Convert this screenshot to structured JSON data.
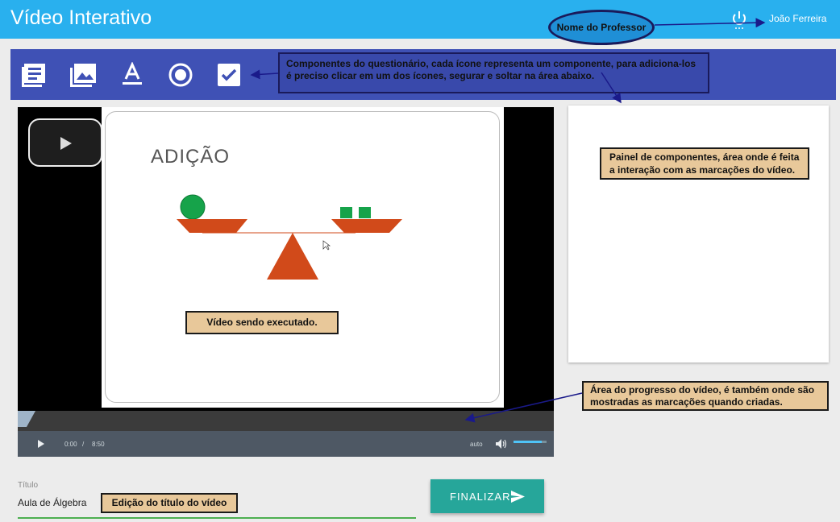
{
  "header": {
    "title": "Vídeo Interativo",
    "user_name": "João Ferreira",
    "power_icon": "power-icon"
  },
  "toolbar": {
    "tools": [
      {
        "name": "text-list-icon"
      },
      {
        "name": "image-gallery-icon"
      },
      {
        "name": "text-format-icon"
      },
      {
        "name": "radio-button-icon"
      },
      {
        "name": "checkbox-icon"
      }
    ]
  },
  "annotations": {
    "professor": "Nome do Professor",
    "components": "Componentes do questionário, cada ícone representa um componente, para adiciona-los é preciso clicar em um dos ícones, segurar e soltar na área abaixo.",
    "panel": "Painel de componentes, área onde é feita a interação com as marcações do vídeo.",
    "video": "Vídeo sendo executado.",
    "progress": "Área do progresso do vídeo, é também onde são mostradas as marcações quando criadas.",
    "title_edit": "Edição do título do vídeo"
  },
  "video": {
    "slide_title": "ADIÇÃO",
    "current_time": "0:00",
    "separator": "/",
    "duration": "8:50",
    "quality": "auto",
    "progress_fraction": 0.0,
    "volume_fraction": 0.85
  },
  "form": {
    "title_label": "Título",
    "title_value": "Aula de Álgebra"
  },
  "actions": {
    "finish_label": "FINALIZAR"
  },
  "colors": {
    "topbar": "#29b0ee",
    "toolbar": "#3f51b5",
    "callout": "#e8c89a",
    "finish_button": "#26a69a"
  }
}
